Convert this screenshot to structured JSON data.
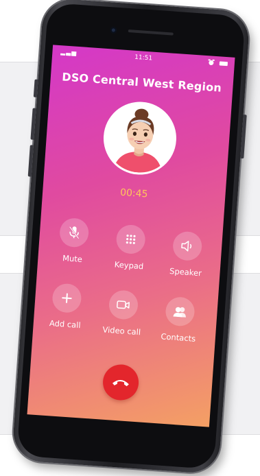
{
  "status_bar": {
    "signal": "▂▃▅",
    "time": "11:51"
  },
  "call": {
    "caller_name": "DSO Central West Region",
    "timer": "00:45"
  },
  "controls": [
    {
      "label": "Mute",
      "icon": "mute-microphone-icon"
    },
    {
      "label": "Keypad",
      "icon": "keypad-icon"
    },
    {
      "label": "Speaker",
      "icon": "speaker-icon"
    },
    {
      "label": "Add call",
      "icon": "plus-icon"
    },
    {
      "label": "Video call",
      "icon": "video-camera-icon"
    },
    {
      "label": "Contacts",
      "icon": "contacts-icon"
    }
  ],
  "end_call": {
    "icon": "hang-up-phone-icon"
  },
  "colors": {
    "end_call": "#e3262c",
    "timer": "#ffc65a",
    "gradient_top": "#d438c8",
    "gradient_bottom": "#f4a064"
  }
}
